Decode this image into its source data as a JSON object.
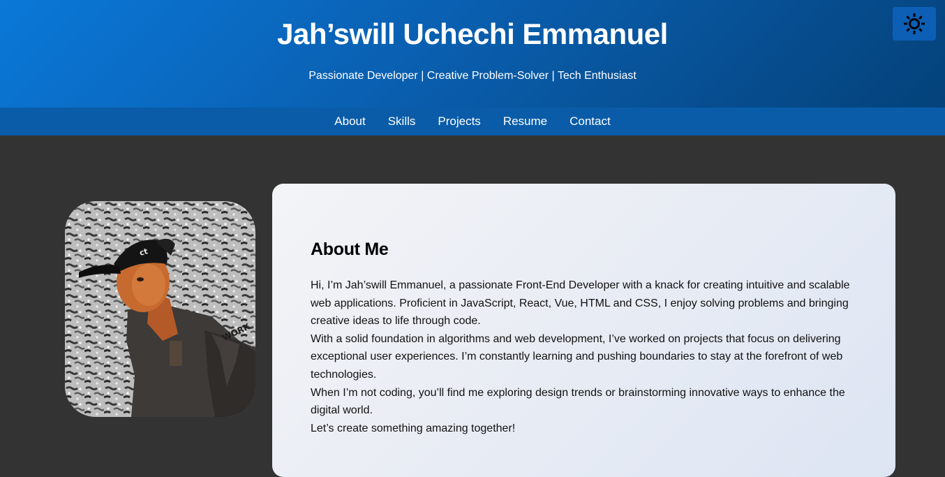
{
  "header": {
    "title": "Jah’swill Uchechi Emmanuel",
    "tagline": "Passionate Developer | Creative Problem-Solver | Tech Enthusiast",
    "theme_toggle_icon": "sun-icon"
  },
  "nav": {
    "items": [
      {
        "label": "About"
      },
      {
        "label": "Skills"
      },
      {
        "label": "Projects"
      },
      {
        "label": "Resume"
      },
      {
        "label": "Contact"
      }
    ]
  },
  "about": {
    "heading": "About Me",
    "paragraphs": [
      "Hi, I’m Jah’swill Emmanuel, a passionate Front-End Developer with a knack for creating intuitive and scalable web applications. Proficient in JavaScript, React, Vue, HTML and CSS, I enjoy solving problems and bringing creative ideas to life through code.",
      "With a solid foundation in algorithms and web development, I’ve worked on projects that focus on delivering exceptional user experiences. I’m constantly learning and pushing boundaries to stay at the forefront of web technologies.",
      "When I’m not coding, you’ll find me exploring design trends or brainstorming innovative ways to enhance the digital world.",
      "Let’s create something amazing together!"
    ]
  },
  "colors": {
    "header_gradient_start": "#0a78d8",
    "header_gradient_end": "#04427a",
    "nav_background": "#0a5ca8",
    "page_background": "#333333",
    "card_background": "#eceff5"
  }
}
